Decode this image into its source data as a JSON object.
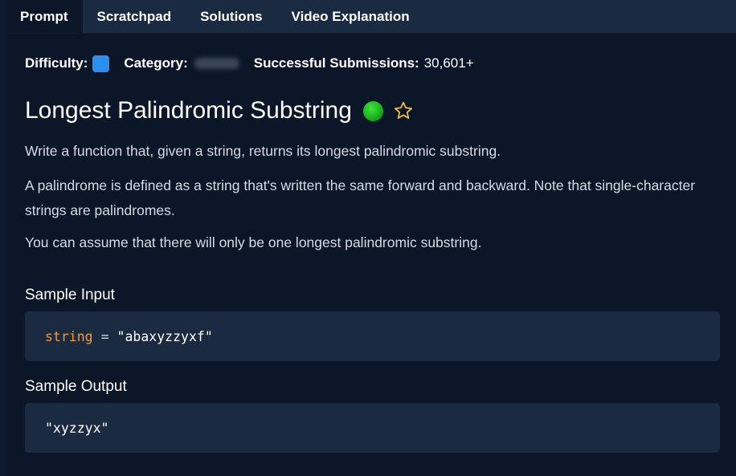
{
  "tabs": [
    {
      "label": "Prompt",
      "active": true
    },
    {
      "label": "Scratchpad",
      "active": false
    },
    {
      "label": "Solutions",
      "active": false
    },
    {
      "label": "Video Explanation",
      "active": false
    }
  ],
  "meta": {
    "difficulty_label": "Difficulty:",
    "difficulty_color": "#2b8ef0",
    "category_label": "Category:",
    "submissions_label": "Successful Submissions:",
    "submissions_value": "30,601+"
  },
  "problem": {
    "title": "Longest Palindromic Substring",
    "status_color": "#22c322",
    "paragraphs": [
      "Write a function that, given a string, returns its longest palindromic substring.",
      "A palindrome is defined as a string that's written the same forward and backward. Note that single-character strings are palindromes.",
      "You can assume that there will only be one longest palindromic substring."
    ]
  },
  "sample_input": {
    "heading": "Sample Input",
    "var": "string",
    "op": "=",
    "value": "\"abaxyzzyxf\""
  },
  "sample_output": {
    "heading": "Sample Output",
    "value": "\"xyzzyx\""
  }
}
